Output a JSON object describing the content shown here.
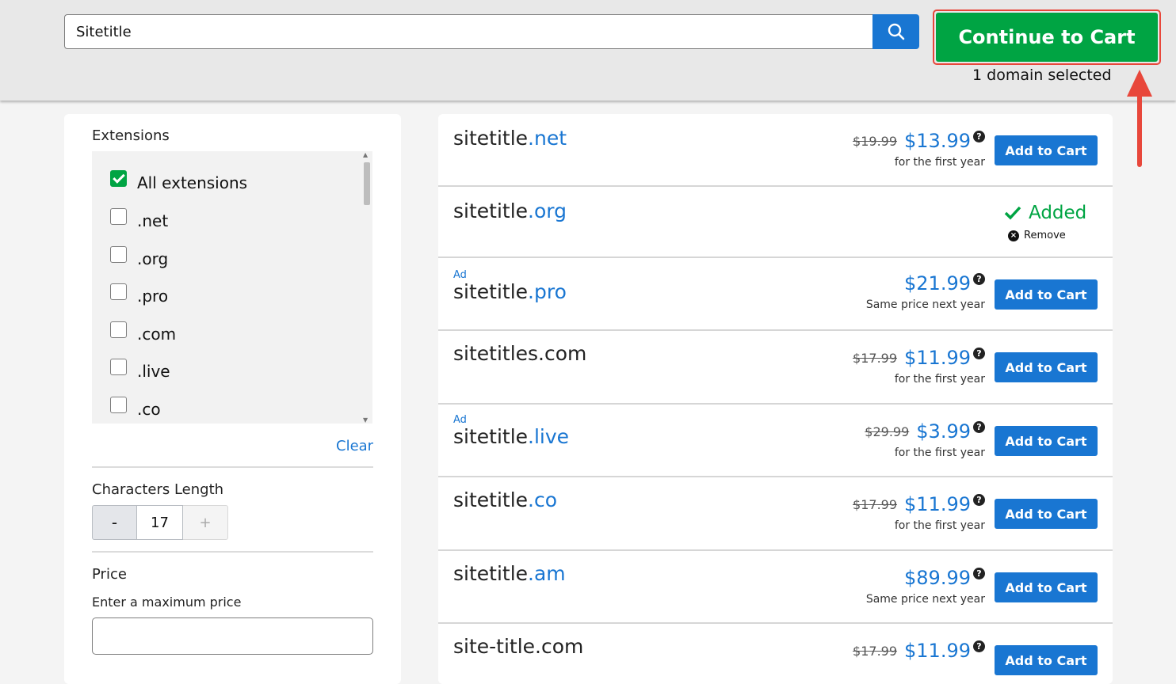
{
  "header": {
    "search_value": "Sitetitle",
    "continue_label": "Continue to Cart",
    "selected_text": "1 domain selected"
  },
  "filters": {
    "extensions_title": "Extensions",
    "extensions": [
      {
        "label": "All extensions",
        "checked": true
      },
      {
        "label": ".net",
        "checked": false
      },
      {
        "label": ".org",
        "checked": false
      },
      {
        "label": ".pro",
        "checked": false
      },
      {
        "label": ".com",
        "checked": false
      },
      {
        "label": ".live",
        "checked": false
      },
      {
        "label": ".co",
        "checked": false
      }
    ],
    "clear_label": "Clear",
    "length_title": "Characters Length",
    "length_minus": "-",
    "length_value": "17",
    "length_plus": "+",
    "price_title": "Price",
    "price_subtitle": "Enter a maximum price",
    "price_value": ""
  },
  "results": [
    {
      "ad": "",
      "name": "sitetitle",
      "tld": ".net",
      "old_price": "$19.99",
      "price": "$13.99",
      "note": "for the first year",
      "button": "Add to Cart"
    },
    {
      "ad": "",
      "name": "sitetitle",
      "tld": ".org",
      "added": true,
      "added_label": "Added",
      "remove_label": "Remove"
    },
    {
      "ad": "Ad",
      "name": "sitetitle",
      "tld": ".pro",
      "old_price": "",
      "price": "$21.99",
      "note": "Same price next year",
      "button": "Add to Cart"
    },
    {
      "ad": "",
      "name": "sitetitles.com",
      "tld": "",
      "old_price": "$17.99",
      "price": "$11.99",
      "note": "for the first year",
      "button": "Add to Cart"
    },
    {
      "ad": "Ad",
      "name": "sitetitle",
      "tld": ".live",
      "old_price": "$29.99",
      "price": "$3.99",
      "note": "for the first year",
      "button": "Add to Cart"
    },
    {
      "ad": "",
      "name": "sitetitle",
      "tld": ".co",
      "old_price": "$17.99",
      "price": "$11.99",
      "note": "for the first year",
      "button": "Add to Cart"
    },
    {
      "ad": "",
      "name": "sitetitle",
      "tld": ".am",
      "old_price": "",
      "price": "$89.99",
      "note": "Same price next year",
      "button": "Add to Cart"
    },
    {
      "ad": "",
      "name": "site-title.com",
      "tld": "",
      "old_price": "$17.99",
      "price": "$11.99",
      "note": "",
      "button": "Add to Cart"
    }
  ],
  "colors": {
    "accent_blue": "#1976d2",
    "cart_green": "#00a443",
    "highlight_red": "#e8473b"
  }
}
